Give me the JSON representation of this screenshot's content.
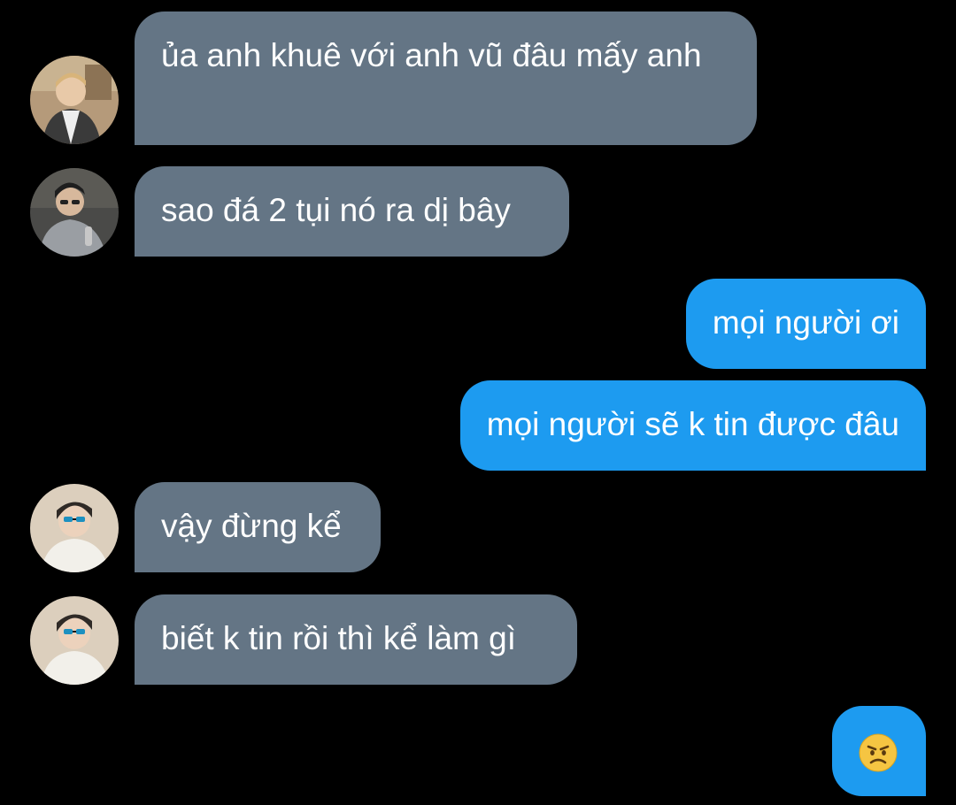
{
  "messages": [
    {
      "sender": "other",
      "avatar_icon": "avatar-photo-man-1",
      "text": "ủa anh khuê với anh vũ đâu mấy anh"
    },
    {
      "sender": "other",
      "avatar_icon": "avatar-photo-man-2",
      "text": "sao đá 2 tụi nó ra dị bây"
    },
    {
      "sender": "me",
      "text": "mọi người ơi"
    },
    {
      "sender": "me",
      "text": "mọi người sẽ k tin được đâu"
    },
    {
      "sender": "other",
      "avatar_icon": "avatar-photo-sunglasses",
      "text": "vậy đừng kể"
    },
    {
      "sender": "other",
      "avatar_icon": "avatar-photo-sunglasses",
      "text": "biết k tin rồi thì kể làm gì"
    },
    {
      "sender": "me",
      "emoji": "angry-face-icon"
    }
  ],
  "colors": {
    "background": "#000000",
    "incoming_bubble": "#647585",
    "outgoing_bubble": "#1d9bf0",
    "text": "#ffffff"
  }
}
